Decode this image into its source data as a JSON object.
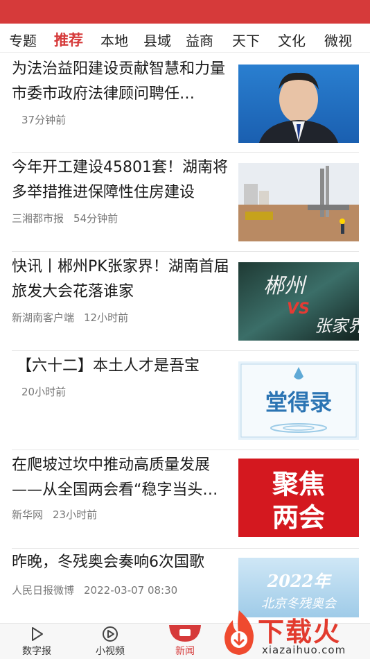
{
  "tabs": [
    "专题",
    "推荐",
    "本地",
    "县域",
    "益商",
    "天下",
    "文化",
    "微视"
  ],
  "active_tab": "推荐",
  "news": [
    {
      "title": "为法治益阳建设贡献智慧和力量 市委市政府法律顾问聘任…",
      "source": "",
      "time": "37分钟前",
      "thumb": "portrait-photo"
    },
    {
      "title": "今年开工建设45801套！湖南将多举措推进保障性住房建设",
      "source": "三湘都市报",
      "time": "54分钟前",
      "thumb": "construction-photo"
    },
    {
      "title": "快讯丨郴州PK张家界！湖南首届旅发大会花落谁家",
      "source": "新湖南客户端",
      "time": "12小时前",
      "thumb": "chenzhou-vs-zhangjiajie"
    },
    {
      "title": "【六十二】本土人才是吾宝",
      "source": "",
      "time": "20小时前",
      "thumb": "tangdelu-banner"
    },
    {
      "title": "在爬坡过坎中推动高质量发展——从全国两会看“稳字当头…",
      "source": "新华网",
      "time": "23小时前",
      "thumb": "focus-two-sessions"
    },
    {
      "title": "昨晚，冬残奥会奏响6次国歌",
      "source": "人民日报微博",
      "time": "2022-03-07 08:30",
      "thumb": "paralympics-2022"
    }
  ],
  "thumb_text": {
    "chenzhou_big": "郴州",
    "vs": "VS",
    "zhangjiajie_big": "张家界",
    "tangdelu": "堂得录",
    "focus_line1": "聚焦",
    "focus_line2": "两会",
    "para_year": "2022年",
    "para_sub": "北京冬残奥会"
  },
  "bottom_nav": [
    {
      "label": "数字报",
      "icon": "newspaper-play-icon"
    },
    {
      "label": "小视频",
      "icon": "video-play-icon"
    },
    {
      "label": "新闻",
      "icon": "news-home-icon",
      "active": true
    }
  ],
  "watermark": {
    "title": "下载火",
    "url": "xiazaihuo.com"
  },
  "colors": {
    "accent": "#d63a3a",
    "text": "#1a1a1a",
    "meta": "#777777",
    "divider": "#e6e6e6"
  }
}
